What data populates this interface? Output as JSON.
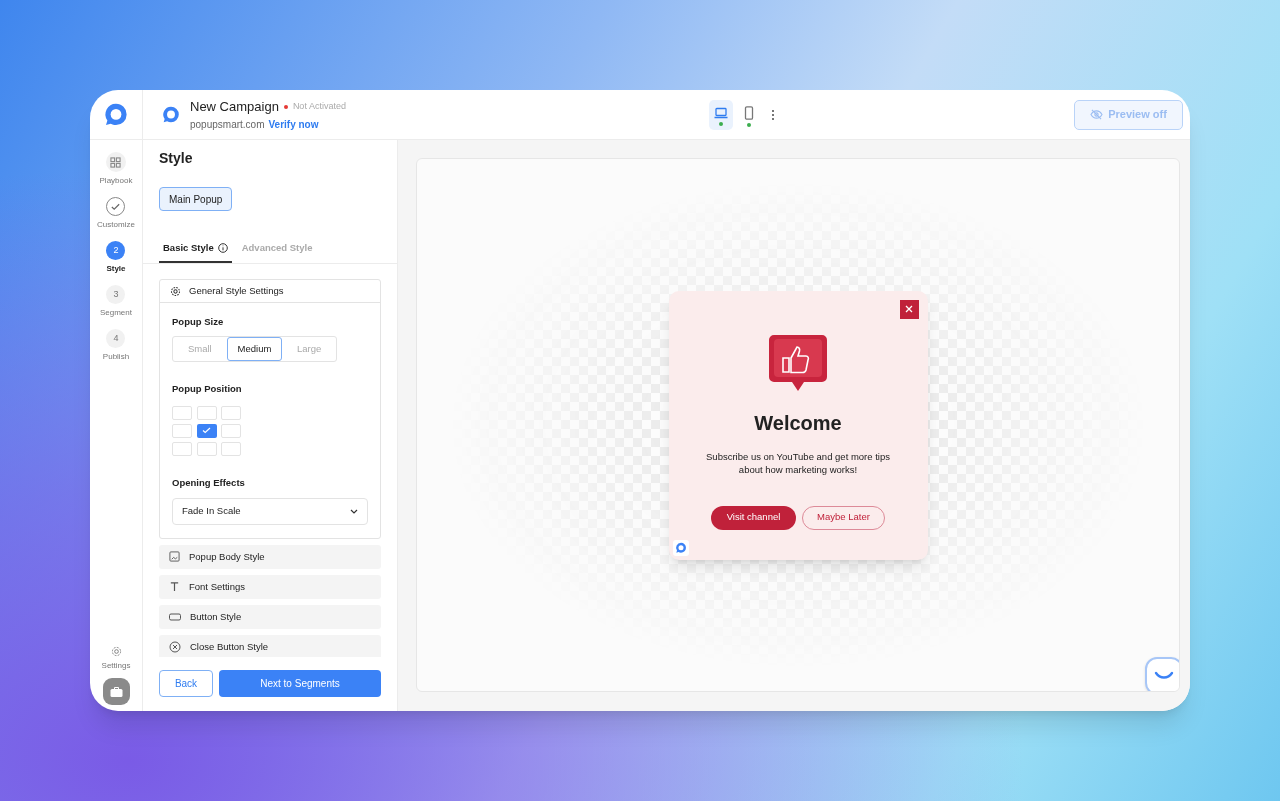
{
  "header": {
    "title": "New Campaign",
    "status": "Not Activated",
    "activated": false,
    "domain": "popupsmart.com",
    "verify_link": "Verify now",
    "devices": [
      {
        "kind": "desktop",
        "selected": true
      },
      {
        "kind": "mobile",
        "selected": false
      }
    ],
    "preview_button": "Preview off"
  },
  "rail": {
    "steps": [
      {
        "label": "Playbook",
        "kind": "grid",
        "selected": false
      },
      {
        "label": "Customize",
        "kind": "done",
        "selected": false
      },
      {
        "label": "Style",
        "kind": "number",
        "number": "2",
        "selected": true
      },
      {
        "label": "Segment",
        "kind": "number",
        "number": "3",
        "selected": false
      },
      {
        "label": "Publish",
        "kind": "number",
        "number": "4",
        "selected": false
      }
    ],
    "settings": "Settings"
  },
  "panel": {
    "title": "Style",
    "popup_chip": "Main Popup",
    "tabs": [
      {
        "label": "Basic Style",
        "selected": true
      },
      {
        "label": "Advanced Style",
        "selected": false
      }
    ],
    "general": {
      "title": "General Style Settings",
      "expanded": true,
      "size_label": "Popup Size",
      "sizes": [
        {
          "label": "Small",
          "selected": false
        },
        {
          "label": "Medium",
          "selected": true
        },
        {
          "label": "Large",
          "selected": false
        }
      ],
      "position_label": "Popup Position",
      "positions": [
        {
          "selected": false
        },
        {
          "selected": false
        },
        {
          "selected": false
        },
        {
          "selected": false
        },
        {
          "selected": true
        },
        {
          "selected": false
        },
        {
          "selected": false
        },
        {
          "selected": false
        },
        {
          "selected": false
        }
      ],
      "effects_label": "Opening Effects",
      "effect": "Fade In Scale"
    },
    "sections": [
      {
        "kind": "image",
        "label": "Popup Body Style"
      },
      {
        "kind": "text",
        "label": "Font Settings"
      },
      {
        "kind": "button",
        "label": "Button Style"
      },
      {
        "kind": "close",
        "label": "Close Button Style"
      }
    ],
    "back": "Back",
    "next": "Next to Segments"
  },
  "popup": {
    "title": "Welcome",
    "text": "Subscribe us on YouTube and get more tips about how marketing works!",
    "primary": "Visit channel",
    "secondary": "Maybe Later"
  }
}
